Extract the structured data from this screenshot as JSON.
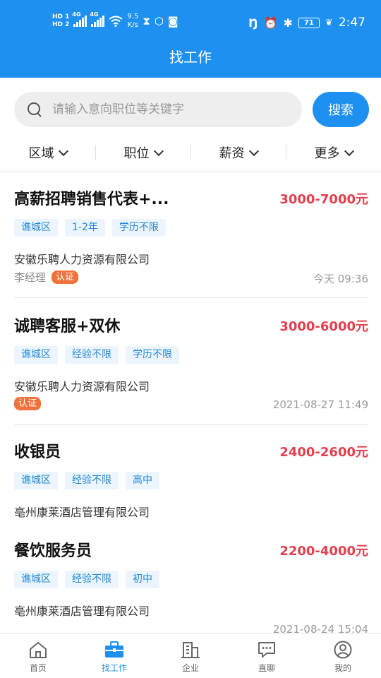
{
  "status_bar": {
    "hd1": "HD 1",
    "hd2": "HD 2",
    "net1": "4G",
    "net2": "4G",
    "speed_value": "9.5",
    "speed_unit": "K/s",
    "battery": "71",
    "time": "2:47"
  },
  "header": {
    "title": "找工作"
  },
  "search": {
    "placeholder": "请输入意向职位等关键字",
    "value": "",
    "button_label": "搜索"
  },
  "filters": [
    {
      "label": "区域"
    },
    {
      "label": "职位"
    },
    {
      "label": "薪资"
    },
    {
      "label": "更多"
    }
  ],
  "jobs": [
    {
      "title": "高薪招聘销售代表+...",
      "salary": "3000-7000元",
      "tags": [
        "谯城区",
        "1-2年",
        "学历不限"
      ],
      "company": "安徽乐聘人力资源有限公司",
      "recruiter": "李经理",
      "badge": "认证",
      "posted": "今天 09:36"
    },
    {
      "title": "诚聘客服+双休",
      "salary": "3000-6000元",
      "tags": [
        "谯城区",
        "经验不限",
        "学历不限"
      ],
      "company": "安徽乐聘人力资源有限公司",
      "recruiter": "",
      "badge": "认证",
      "posted": "2021-08-27 11:49"
    },
    {
      "title": "收银员",
      "salary": "2400-2600元",
      "tags": [
        "谯城区",
        "经验不限",
        "高中"
      ],
      "company": "亳州康莱酒店管理有限公司",
      "recruiter": "",
      "badge": "",
      "posted": ""
    },
    {
      "title": "餐饮服务员",
      "salary": "2200-4000元",
      "tags": [
        "谯城区",
        "经验不限",
        "初中"
      ],
      "company": "亳州康莱酒店管理有限公司",
      "recruiter": "",
      "badge": "",
      "posted": "2021-08-24 15:04"
    }
  ],
  "bottom_nav": [
    {
      "label": "首页",
      "icon": "home-icon"
    },
    {
      "label": "找工作",
      "icon": "briefcase-icon"
    },
    {
      "label": "企业",
      "icon": "building-icon"
    },
    {
      "label": "直聊",
      "icon": "chat-icon"
    },
    {
      "label": "我的",
      "icon": "user-icon"
    }
  ],
  "colors": {
    "primary": "#1e90ef",
    "salary": "#e2404e",
    "badge": "#f0713a",
    "tag_text": "#1f89d6",
    "tag_bg": "#ecf5fd"
  }
}
